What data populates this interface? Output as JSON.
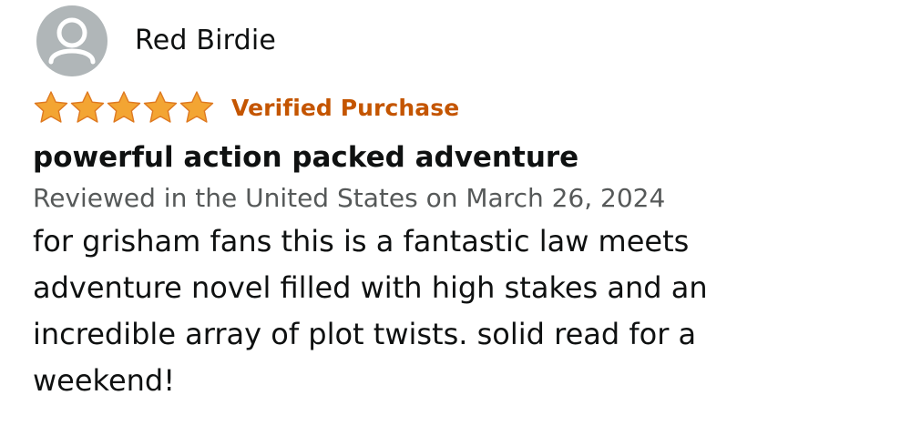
{
  "review": {
    "reviewer_name": "Red Birdie",
    "avatar_icon": "user-silhouette-icon",
    "rating": 5,
    "rating_max": 5,
    "star_icon": "star-filled-icon",
    "star_color": "#f3a533",
    "verified_label": "Verified Purchase",
    "verified_color": "#c45500",
    "title": "powerful action packed adventure",
    "date_line": "Reviewed in the United States on March 26, 2024",
    "body": "for grisham fans this is a fantastic law meets adventure novel filled with high stakes and an incredible array of plot twists. solid read for a weekend!"
  }
}
